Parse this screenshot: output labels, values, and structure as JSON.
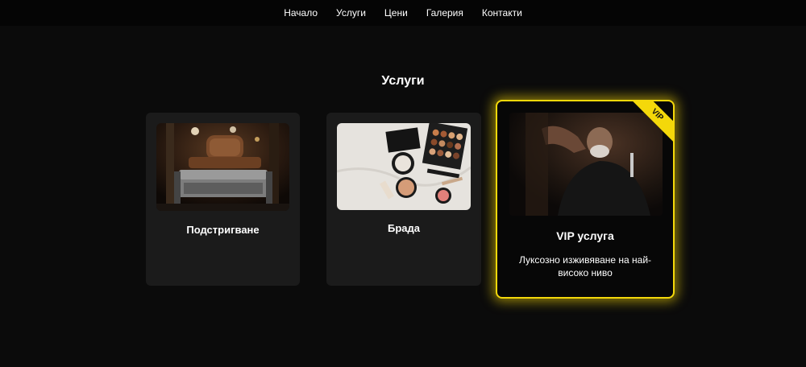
{
  "nav": {
    "items": [
      "Начало",
      "Услуги",
      "Цени",
      "Галерия",
      "Контакти"
    ]
  },
  "section": {
    "title": "Услуги"
  },
  "cards": [
    {
      "title": "Подстригване",
      "image_icon": "barber-chair-photo"
    },
    {
      "title": "Брада",
      "image_icon": "cosmetics-flatlay-photo"
    },
    {
      "title": "VIP услуга",
      "description": "Луксозно изживяване на най-високо ниво",
      "badge": "VIP",
      "image_icon": "barber-shaving-client-photo"
    }
  ],
  "colors": {
    "background": "#0b0b0b",
    "card": "#1b1b1b",
    "accent": "#f4d80a"
  }
}
